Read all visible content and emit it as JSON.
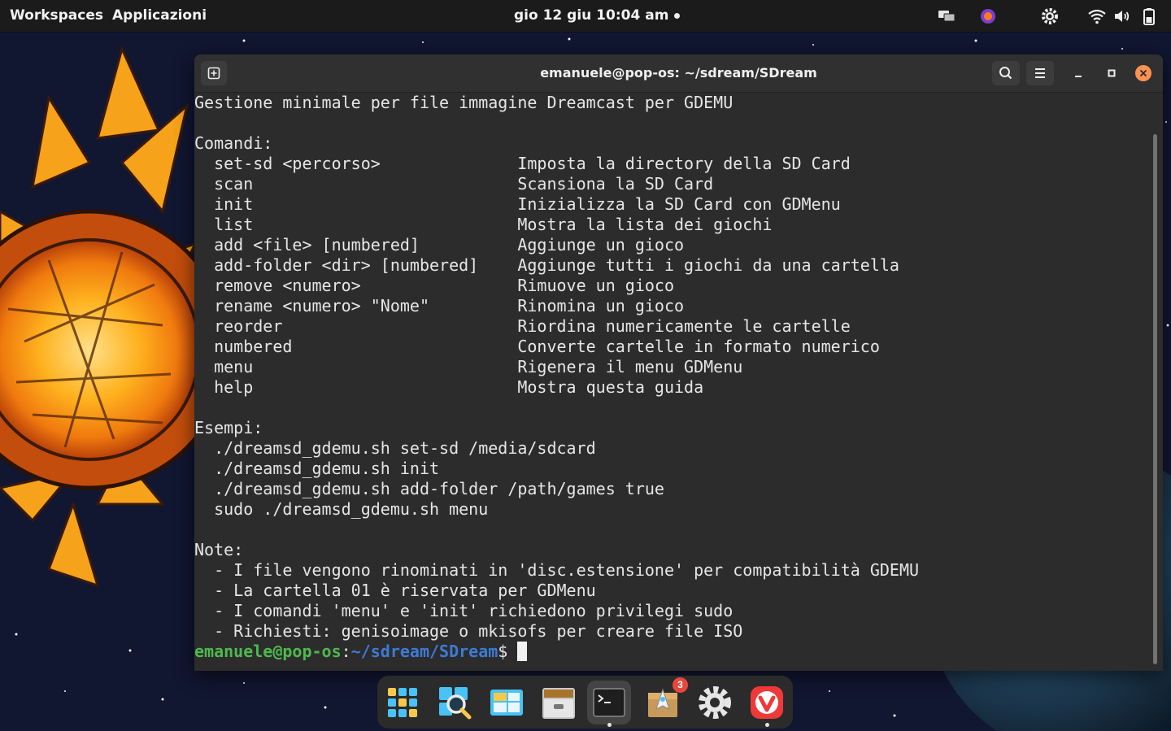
{
  "topbar": {
    "workspaces": "Workspaces",
    "applications": "Applicazioni",
    "clock": "gio 12 giu  10:04 am"
  },
  "terminal": {
    "title": "emanuele@pop-os: ~/sdream/SDream",
    "lines": [
      "Gestione minimale per file immagine Dreamcast per GDEMU",
      "",
      "Comandi:",
      "  set-sd <percorso>              Imposta la directory della SD Card",
      "  scan                           Scansiona la SD Card",
      "  init                           Inizializza la SD Card con GDMenu",
      "  list                           Mostra la lista dei giochi",
      "  add <file> [numbered]          Aggiunge un gioco",
      "  add-folder <dir> [numbered]    Aggiunge tutti i giochi da una cartella",
      "  remove <numero>                Rimuove un gioco",
      "  rename <numero> \"Nome\"         Rinomina un gioco",
      "  reorder                        Riordina numericamente le cartelle",
      "  numbered                       Converte cartelle in formato numerico",
      "  menu                           Rigenera il menu GDMenu",
      "  help                           Mostra questa guida",
      "",
      "Esempi:",
      "  ./dreamsd_gdemu.sh set-sd /media/sdcard",
      "  ./dreamsd_gdemu.sh init",
      "  ./dreamsd_gdemu.sh add-folder /path/games true",
      "  sudo ./dreamsd_gdemu.sh menu",
      "",
      "Note:",
      "  - I file vengono rinominati in 'disc.estensione' per compatibilità GDEMU",
      "  - La cartella 01 è riservata per GDMenu",
      "  - I comandi 'menu' e 'init' richiedono privilegi sudo",
      "  - Richiesti: genisoimage o mkisofs per creare file ISO"
    ],
    "prompt": {
      "user": "emanuele@pop-os",
      "colon": ":",
      "path": "~/sdream/SDream",
      "symbol": "$ "
    }
  },
  "dock": {
    "items": [
      "app-grid-icon",
      "search-icon",
      "workspaces-icon",
      "files-icon",
      "terminal-icon",
      "pop-shop-icon",
      "settings-icon",
      "vivaldi-icon"
    ],
    "badge": "3"
  },
  "colors": {
    "terminal_bg": "#2c2c2c",
    "prompt_user": "#4eb94c",
    "prompt_path": "#3d7bd6",
    "close_button": "#fb9252"
  }
}
